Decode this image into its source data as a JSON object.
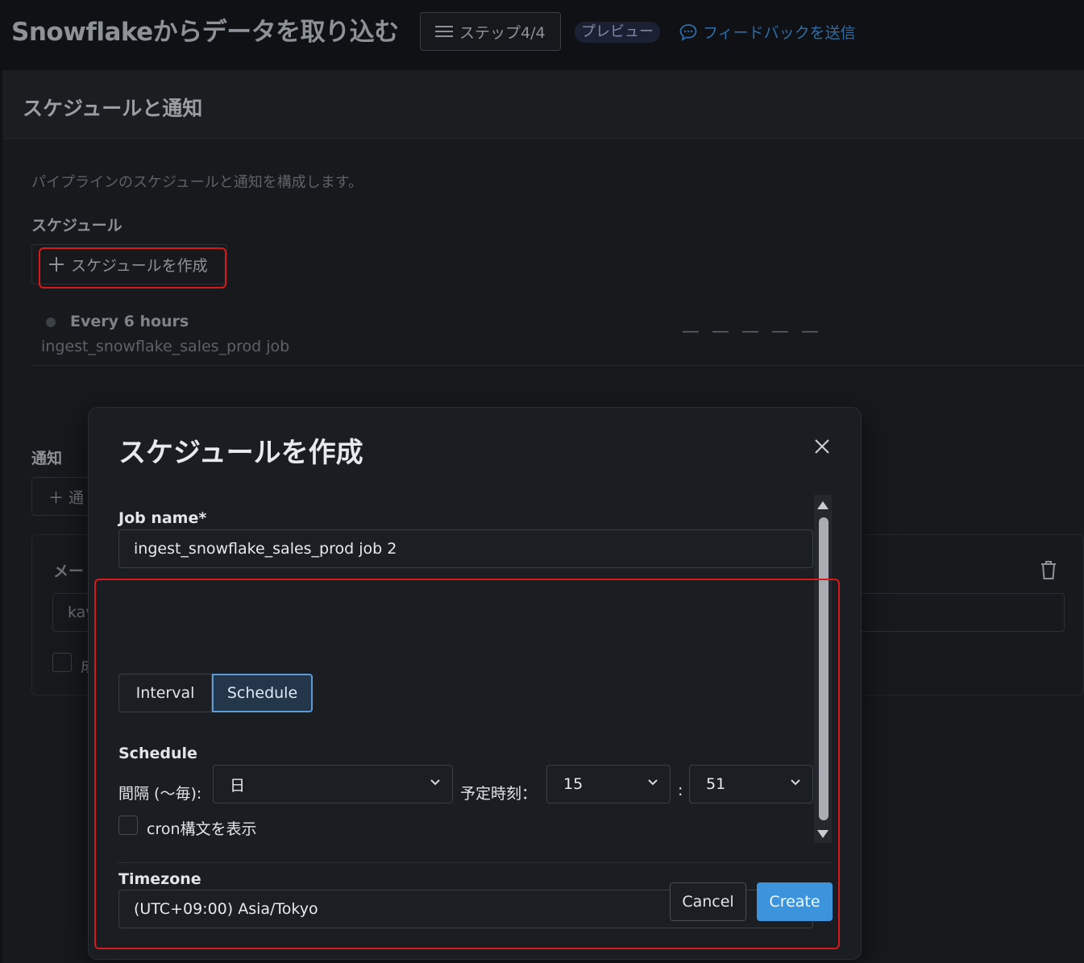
{
  "header": {
    "title": "Snowflakeからデータを取り込む",
    "step": "ステップ4/4",
    "preview_badge": "プレビュー",
    "feedback": "フィードバックを送信"
  },
  "panel": {
    "title": "スケジュールと通知",
    "description": "パイプラインのスケジュールと通知を構成します。",
    "schedule_section_label": "スケジュール",
    "create_schedule_button": "スケジュールを作成",
    "existing_schedule": {
      "frequency": "Every 6 hours",
      "job": "ingest_snowflake_sales_prod job",
      "placeholder": "— — — — —"
    },
    "notify_section_label": "通知",
    "notify_add_button": "通",
    "mail_card_title": "メー",
    "mail_input_value": "kav",
    "mail_check_label": "成"
  },
  "modal": {
    "title": "スケジュールを作成",
    "job_name_label": "Job name*",
    "job_name_value": "ingest_snowflake_sales_prod job 2",
    "tabs": [
      "Interval",
      "Schedule"
    ],
    "active_tab": "Schedule",
    "schedule_label": "Schedule",
    "interval_label": "間隔 (〜毎):",
    "interval_value": "日",
    "time_label": "予定時刻：",
    "hour_value": "15",
    "minute_value": "51",
    "time_separator": ":",
    "cron_label": "cron構文を表示",
    "timezone_label": "Timezone",
    "timezone_value": "(UTC+09:00) Asia/Tokyo",
    "cancel": "Cancel",
    "create": "Create"
  },
  "colors": {
    "accent": "#3b94dc",
    "highlight": "#d61a1a",
    "active_tab_border": "#5b9bd5"
  }
}
